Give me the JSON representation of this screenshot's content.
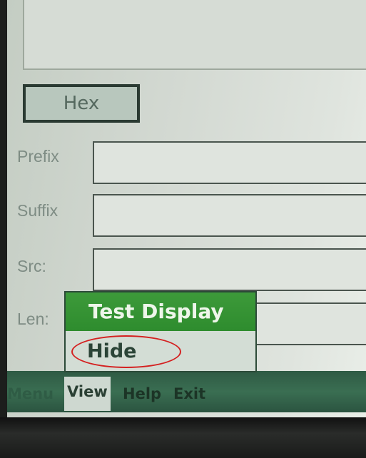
{
  "form": {
    "hex_button_label": "Hex",
    "prefix_label": "Prefix",
    "suffix_label": "Suffix",
    "src_label": "Src:",
    "len_label": "Len:"
  },
  "menubar": {
    "menu_label": "Menu",
    "view_label": "View",
    "help_label": "Help",
    "exit_label": "Exit"
  },
  "view_menu": {
    "items": [
      {
        "label": "Test Display",
        "selected": true
      },
      {
        "label": "Hide",
        "selected": false
      }
    ]
  },
  "annotation_color": "#d42020"
}
